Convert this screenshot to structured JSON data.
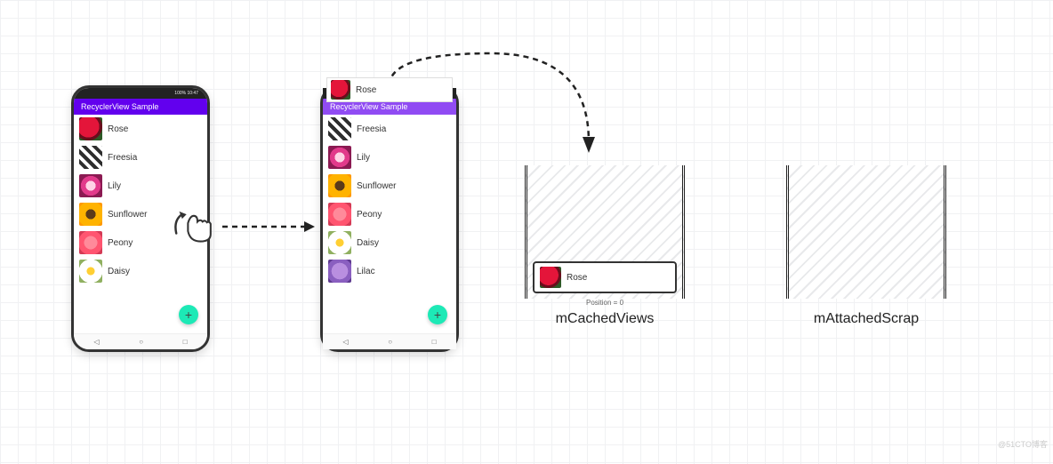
{
  "app_title": "RecyclerView Sample",
  "status_left": "",
  "status_right": "100% 10:47",
  "phone1": {
    "items": [
      {
        "label": "Rose",
        "swatch": "sw-rose"
      },
      {
        "label": "Freesia",
        "swatch": "sw-freesia"
      },
      {
        "label": "Lily",
        "swatch": "sw-lily"
      },
      {
        "label": "Sunflower",
        "swatch": "sw-sunflower"
      },
      {
        "label": "Peony",
        "swatch": "sw-peony"
      },
      {
        "label": "Daisy",
        "swatch": "sw-daisy"
      }
    ]
  },
  "phone2": {
    "overflow": {
      "label": "Rose",
      "swatch": "sw-rose"
    },
    "items": [
      {
        "label": "Freesia",
        "swatch": "sw-freesia"
      },
      {
        "label": "Lily",
        "swatch": "sw-lily"
      },
      {
        "label": "Sunflower",
        "swatch": "sw-sunflower"
      },
      {
        "label": "Peony",
        "swatch": "sw-peony"
      },
      {
        "label": "Daisy",
        "swatch": "sw-daisy"
      },
      {
        "label": "Lilac",
        "swatch": "sw-lilac"
      }
    ]
  },
  "fab_label": "+",
  "nav": {
    "back": "◁",
    "home": "○",
    "recent": "□"
  },
  "cache1": {
    "label": "mCachedViews",
    "item": {
      "label": "Rose",
      "swatch": "sw-rose"
    },
    "position_text": "Position = 0"
  },
  "cache2": {
    "label": "mAttachedScrap"
  },
  "watermark": "@51CTO博客"
}
